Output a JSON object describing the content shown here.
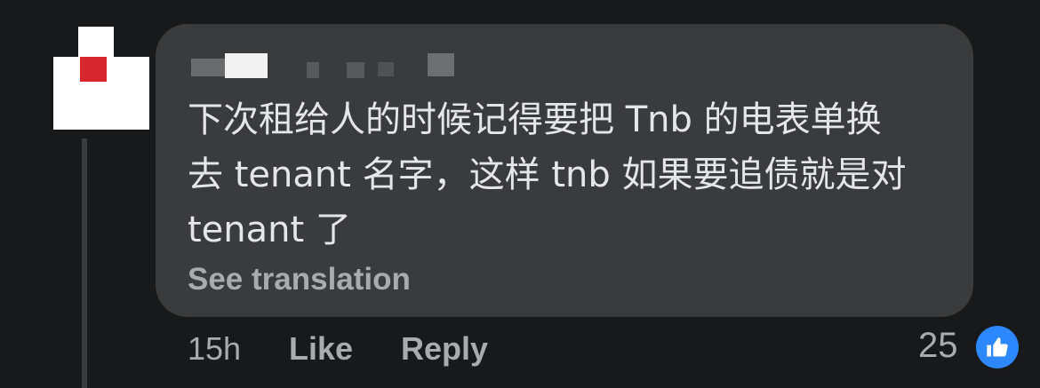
{
  "comment": {
    "author_name": "",
    "text_lines": [
      "下次租给人的时候记得要把 Tnb 的电表单换",
      "去 tenant 名字，这样 tnb 如果要追债就是对",
      "tenant 了"
    ],
    "see_translation": "See translation",
    "timestamp": "15h",
    "like_label": "Like",
    "reply_label": "Reply",
    "reaction_count": "25",
    "reaction_icon": "thumbs-up-icon"
  },
  "colors": {
    "background": "#18191a",
    "bubble": "#3a3b3c",
    "text": "#e4e6eb",
    "secondary_text": "#a8abaf",
    "like_blue": "#2d88ff"
  }
}
